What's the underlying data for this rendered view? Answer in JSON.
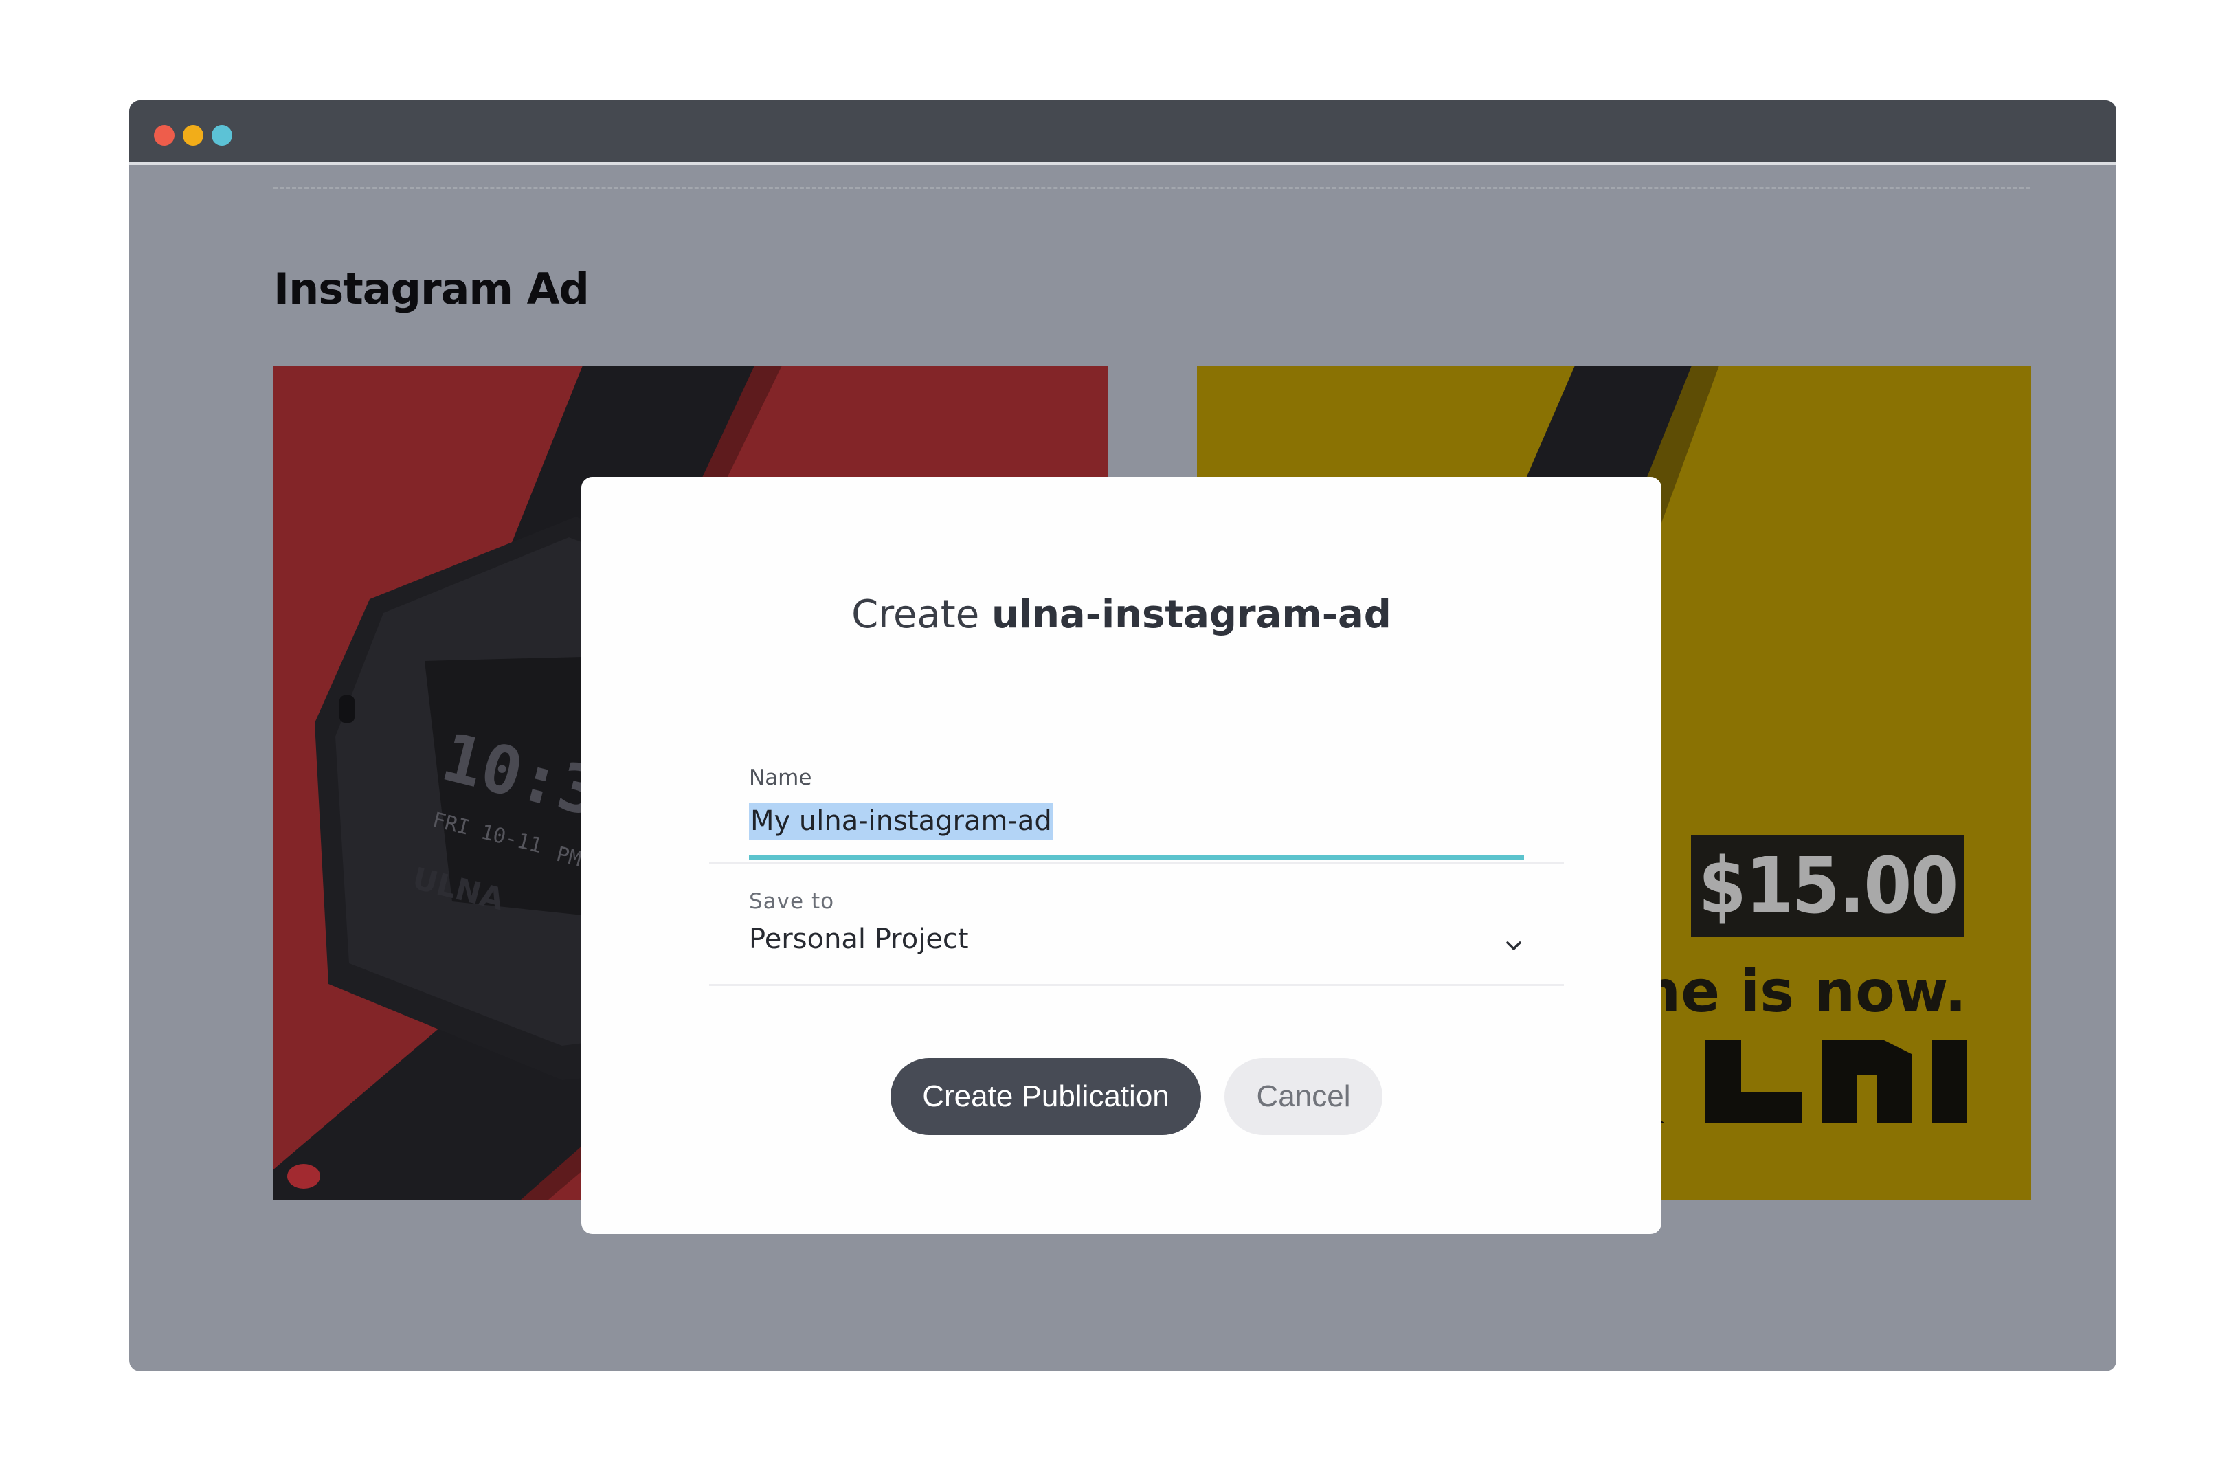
{
  "window": {
    "controls": [
      "close",
      "minimize",
      "maximize"
    ]
  },
  "page": {
    "title": "Instagram Ad"
  },
  "ads": {
    "left": {
      "background": "#832528",
      "watch_time": "10:35",
      "watch_date": "FRI 10-11",
      "watch_period": "PM",
      "watch_brand": "ULNA"
    },
    "right": {
      "background": "#8a7203",
      "price": "$15.00",
      "tagline": "ime is now.",
      "logo": "ULNA"
    }
  },
  "modal": {
    "title_prefix": "Create ",
    "title_name": "ulna-instagram-ad",
    "name_label": "Name",
    "name_value": "My ulna-instagram-ad",
    "save_label": "Save to",
    "save_value": "Personal Project",
    "create_button": "Create Publication",
    "cancel_button": "Cancel"
  },
  "colors": {
    "accent": "#5bc3cd",
    "selection": "#b3d4f6",
    "primary_button": "#474b55"
  }
}
